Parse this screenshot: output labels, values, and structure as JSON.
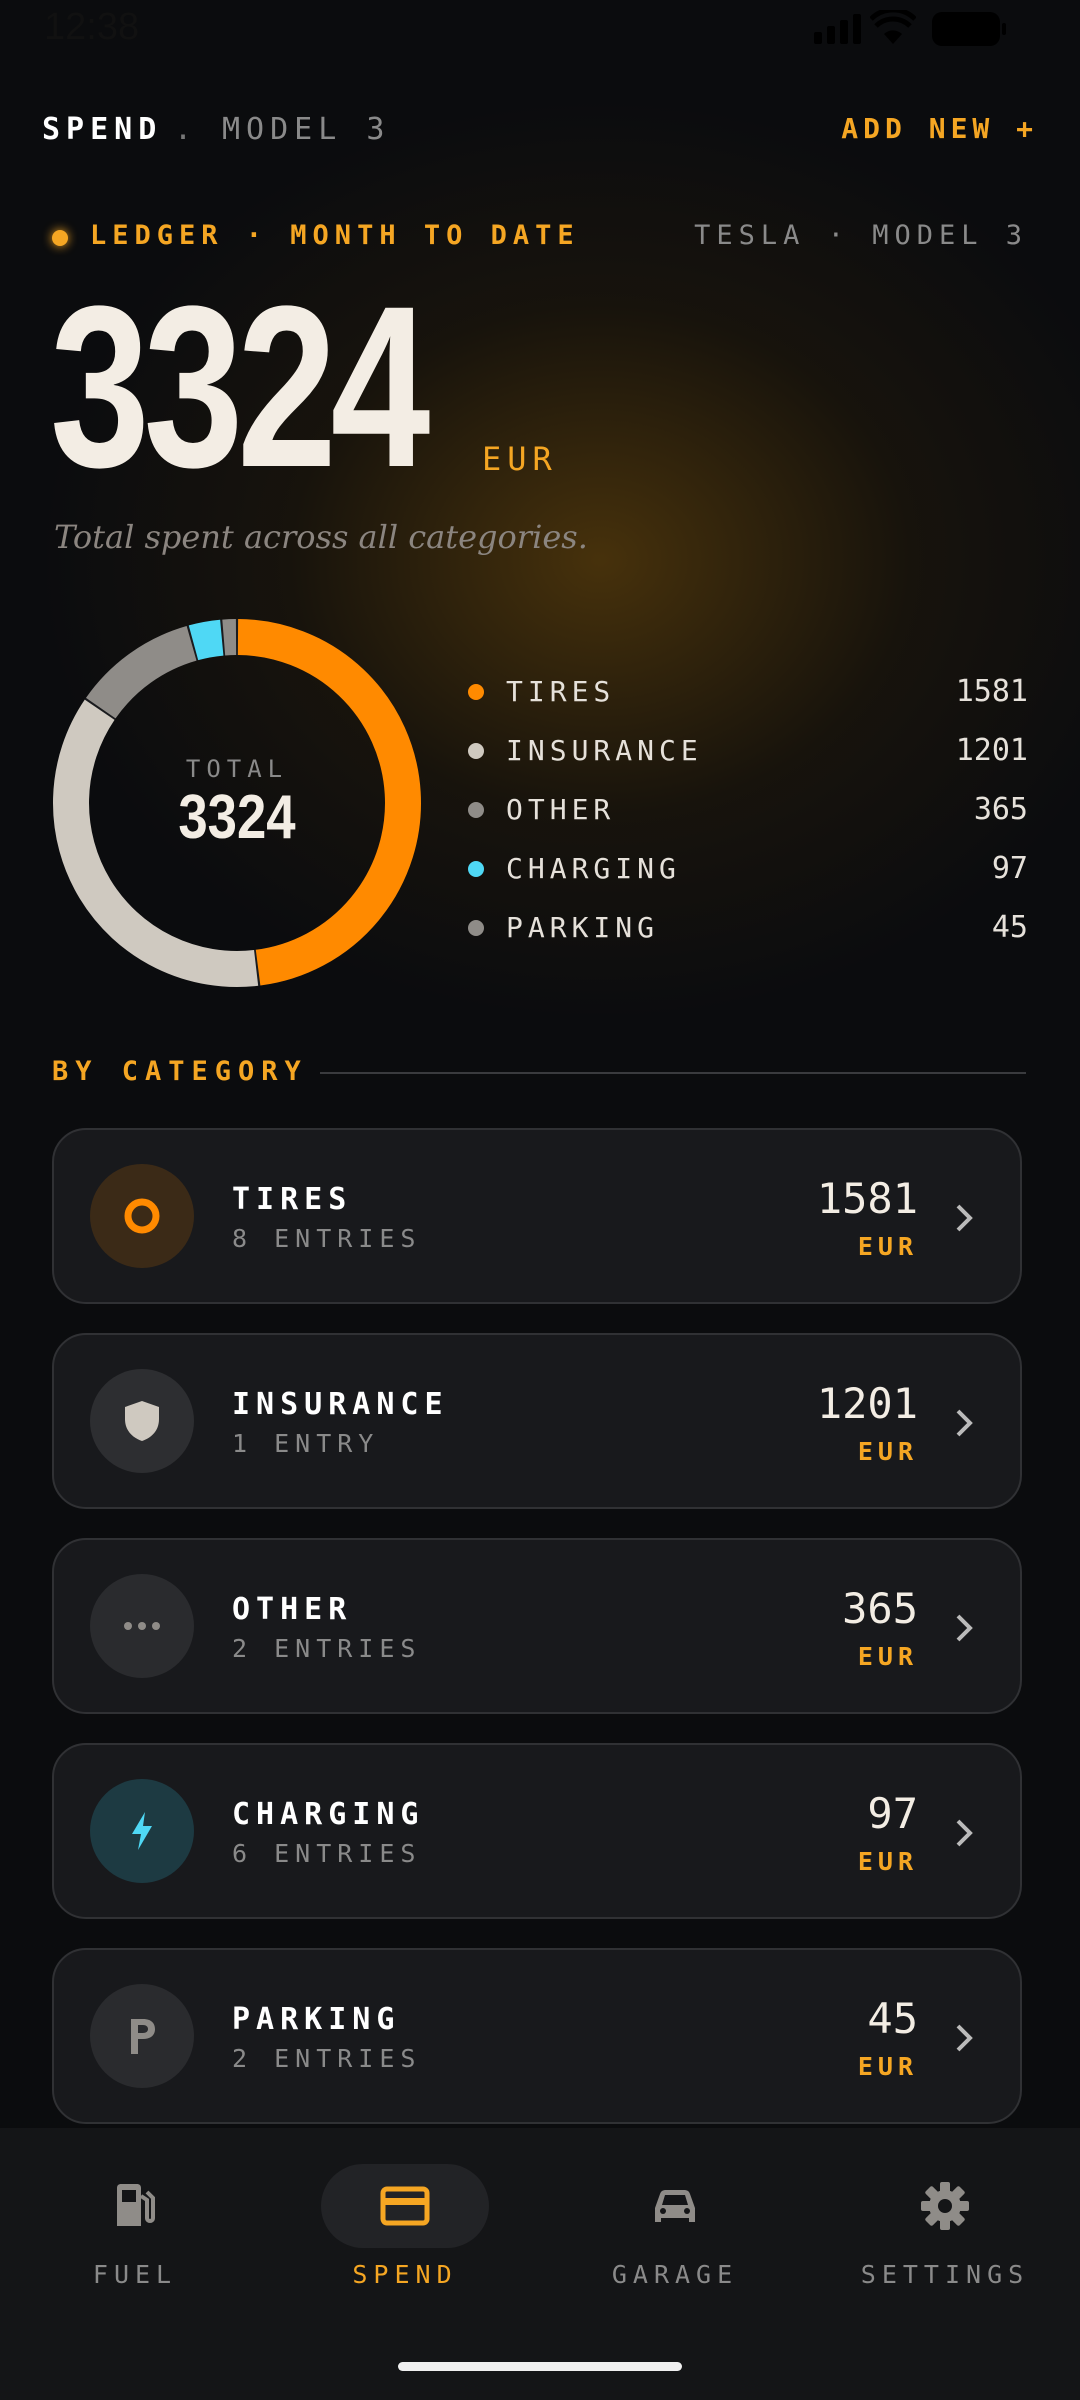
{
  "status_bar": {
    "time": "12:38"
  },
  "header": {
    "title": "SPEND",
    "separator": ".",
    "subtitle": "MODEL 3",
    "add_label": "ADD NEW +"
  },
  "ledger": {
    "label": "LEDGER · MONTH TO DATE",
    "vehicle": "TESLA · MODEL 3"
  },
  "summary": {
    "total": "3324",
    "unit": "EUR",
    "caption": "Total spent across all categories."
  },
  "donut": {
    "caption": "TOTAL",
    "value": "3324"
  },
  "colors": {
    "accent": "#f5a623",
    "tires": "#ff8a00",
    "insurance": "#cfc9c0",
    "other": "#8f8c88",
    "charging": "#4fd8f5",
    "parking": "#8f8c88"
  },
  "chart_data": {
    "type": "pie",
    "categories": [
      "TIRES",
      "INSURANCE",
      "OTHER",
      "CHARGING",
      "PARKING"
    ],
    "values": [
      1581,
      1201,
      365,
      97,
      45
    ]
  },
  "legend": [
    {
      "name": "TIRES",
      "value": "1581",
      "color": "#ff8a00"
    },
    {
      "name": "INSURANCE",
      "value": "1201",
      "color": "#cfc9c0"
    },
    {
      "name": "OTHER",
      "value": "365",
      "color": "#8f8c88"
    },
    {
      "name": "CHARGING",
      "value": "97",
      "color": "#4fd8f5"
    },
    {
      "name": "PARKING",
      "value": "45",
      "color": "#8f8c88"
    }
  ],
  "section": {
    "title": "BY CATEGORY"
  },
  "categories": [
    {
      "name": "TIRES",
      "entries": "8 ENTRIES",
      "amount": "1581",
      "unit": "EUR",
      "icon": "tire-ring-icon"
    },
    {
      "name": "INSURANCE",
      "entries": "1 ENTRY",
      "amount": "1201",
      "unit": "EUR",
      "icon": "shield-icon"
    },
    {
      "name": "OTHER",
      "entries": "2 ENTRIES",
      "amount": "365",
      "unit": "EUR",
      "icon": "more-dots-icon"
    },
    {
      "name": "CHARGING",
      "entries": "6 ENTRIES",
      "amount": "97",
      "unit": "EUR",
      "icon": "lightning-bolt-icon"
    },
    {
      "name": "PARKING",
      "entries": "2 ENTRIES",
      "amount": "45",
      "unit": "EUR",
      "icon": "parking-p-icon"
    }
  ],
  "nav": [
    {
      "label": "FUEL",
      "icon": "fuel-pump-icon",
      "active": false
    },
    {
      "label": "SPEND",
      "icon": "credit-card-icon",
      "active": true
    },
    {
      "label": "GARAGE",
      "icon": "car-icon",
      "active": false
    },
    {
      "label": "SETTINGS",
      "icon": "gear-icon",
      "active": false
    }
  ]
}
